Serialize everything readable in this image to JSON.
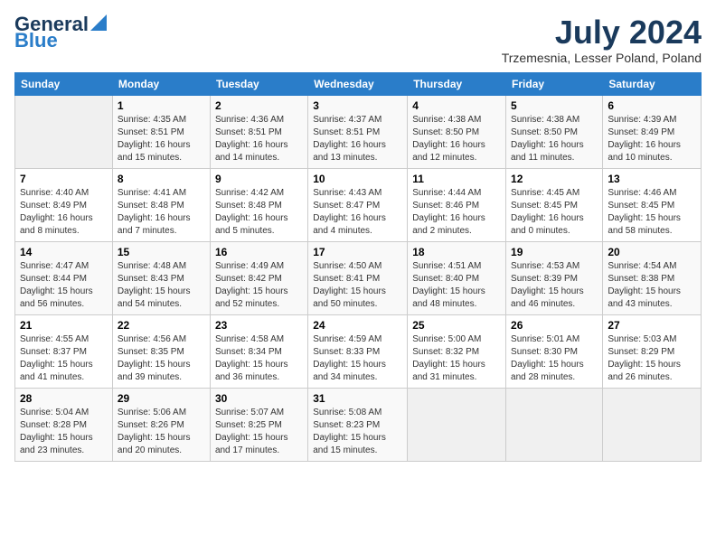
{
  "header": {
    "logo_general": "General",
    "logo_blue": "Blue",
    "month_title": "July 2024",
    "location": "Trzemesnia, Lesser Poland, Poland"
  },
  "days_of_week": [
    "Sunday",
    "Monday",
    "Tuesday",
    "Wednesday",
    "Thursday",
    "Friday",
    "Saturday"
  ],
  "weeks": [
    [
      {
        "day": "",
        "info": ""
      },
      {
        "day": "1",
        "info": "Sunrise: 4:35 AM\nSunset: 8:51 PM\nDaylight: 16 hours\nand 15 minutes."
      },
      {
        "day": "2",
        "info": "Sunrise: 4:36 AM\nSunset: 8:51 PM\nDaylight: 16 hours\nand 14 minutes."
      },
      {
        "day": "3",
        "info": "Sunrise: 4:37 AM\nSunset: 8:51 PM\nDaylight: 16 hours\nand 13 minutes."
      },
      {
        "day": "4",
        "info": "Sunrise: 4:38 AM\nSunset: 8:50 PM\nDaylight: 16 hours\nand 12 minutes."
      },
      {
        "day": "5",
        "info": "Sunrise: 4:38 AM\nSunset: 8:50 PM\nDaylight: 16 hours\nand 11 minutes."
      },
      {
        "day": "6",
        "info": "Sunrise: 4:39 AM\nSunset: 8:49 PM\nDaylight: 16 hours\nand 10 minutes."
      }
    ],
    [
      {
        "day": "7",
        "info": "Sunrise: 4:40 AM\nSunset: 8:49 PM\nDaylight: 16 hours\nand 8 minutes."
      },
      {
        "day": "8",
        "info": "Sunrise: 4:41 AM\nSunset: 8:48 PM\nDaylight: 16 hours\nand 7 minutes."
      },
      {
        "day": "9",
        "info": "Sunrise: 4:42 AM\nSunset: 8:48 PM\nDaylight: 16 hours\nand 5 minutes."
      },
      {
        "day": "10",
        "info": "Sunrise: 4:43 AM\nSunset: 8:47 PM\nDaylight: 16 hours\nand 4 minutes."
      },
      {
        "day": "11",
        "info": "Sunrise: 4:44 AM\nSunset: 8:46 PM\nDaylight: 16 hours\nand 2 minutes."
      },
      {
        "day": "12",
        "info": "Sunrise: 4:45 AM\nSunset: 8:45 PM\nDaylight: 16 hours\nand 0 minutes."
      },
      {
        "day": "13",
        "info": "Sunrise: 4:46 AM\nSunset: 8:45 PM\nDaylight: 15 hours\nand 58 minutes."
      }
    ],
    [
      {
        "day": "14",
        "info": "Sunrise: 4:47 AM\nSunset: 8:44 PM\nDaylight: 15 hours\nand 56 minutes."
      },
      {
        "day": "15",
        "info": "Sunrise: 4:48 AM\nSunset: 8:43 PM\nDaylight: 15 hours\nand 54 minutes."
      },
      {
        "day": "16",
        "info": "Sunrise: 4:49 AM\nSunset: 8:42 PM\nDaylight: 15 hours\nand 52 minutes."
      },
      {
        "day": "17",
        "info": "Sunrise: 4:50 AM\nSunset: 8:41 PM\nDaylight: 15 hours\nand 50 minutes."
      },
      {
        "day": "18",
        "info": "Sunrise: 4:51 AM\nSunset: 8:40 PM\nDaylight: 15 hours\nand 48 minutes."
      },
      {
        "day": "19",
        "info": "Sunrise: 4:53 AM\nSunset: 8:39 PM\nDaylight: 15 hours\nand 46 minutes."
      },
      {
        "day": "20",
        "info": "Sunrise: 4:54 AM\nSunset: 8:38 PM\nDaylight: 15 hours\nand 43 minutes."
      }
    ],
    [
      {
        "day": "21",
        "info": "Sunrise: 4:55 AM\nSunset: 8:37 PM\nDaylight: 15 hours\nand 41 minutes."
      },
      {
        "day": "22",
        "info": "Sunrise: 4:56 AM\nSunset: 8:35 PM\nDaylight: 15 hours\nand 39 minutes."
      },
      {
        "day": "23",
        "info": "Sunrise: 4:58 AM\nSunset: 8:34 PM\nDaylight: 15 hours\nand 36 minutes."
      },
      {
        "day": "24",
        "info": "Sunrise: 4:59 AM\nSunset: 8:33 PM\nDaylight: 15 hours\nand 34 minutes."
      },
      {
        "day": "25",
        "info": "Sunrise: 5:00 AM\nSunset: 8:32 PM\nDaylight: 15 hours\nand 31 minutes."
      },
      {
        "day": "26",
        "info": "Sunrise: 5:01 AM\nSunset: 8:30 PM\nDaylight: 15 hours\nand 28 minutes."
      },
      {
        "day": "27",
        "info": "Sunrise: 5:03 AM\nSunset: 8:29 PM\nDaylight: 15 hours\nand 26 minutes."
      }
    ],
    [
      {
        "day": "28",
        "info": "Sunrise: 5:04 AM\nSunset: 8:28 PM\nDaylight: 15 hours\nand 23 minutes."
      },
      {
        "day": "29",
        "info": "Sunrise: 5:06 AM\nSunset: 8:26 PM\nDaylight: 15 hours\nand 20 minutes."
      },
      {
        "day": "30",
        "info": "Sunrise: 5:07 AM\nSunset: 8:25 PM\nDaylight: 15 hours\nand 17 minutes."
      },
      {
        "day": "31",
        "info": "Sunrise: 5:08 AM\nSunset: 8:23 PM\nDaylight: 15 hours\nand 15 minutes."
      },
      {
        "day": "",
        "info": ""
      },
      {
        "day": "",
        "info": ""
      },
      {
        "day": "",
        "info": ""
      }
    ]
  ]
}
